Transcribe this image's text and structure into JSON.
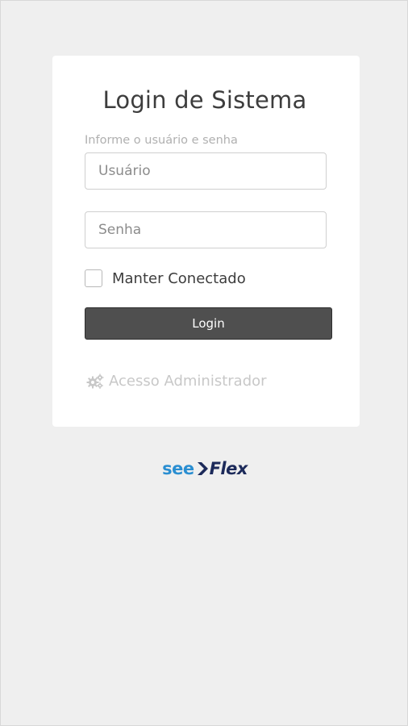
{
  "login": {
    "title": "Login de Sistema",
    "hint": "Informe o usuário e senha",
    "username_placeholder": "Usuário",
    "password_placeholder": "Senha",
    "remember_label": "Manter Conectado",
    "login_button": "Login",
    "admin_link": "Acesso Administrador"
  },
  "brand": {
    "logo_part1": "see",
    "logo_part2": "Flex",
    "color_primary": "#2a8ed1",
    "color_secondary": "#1c2a5a"
  },
  "icons": {
    "admin_icon": "gears-icon",
    "logo_icon": "chevron-right-icon"
  }
}
